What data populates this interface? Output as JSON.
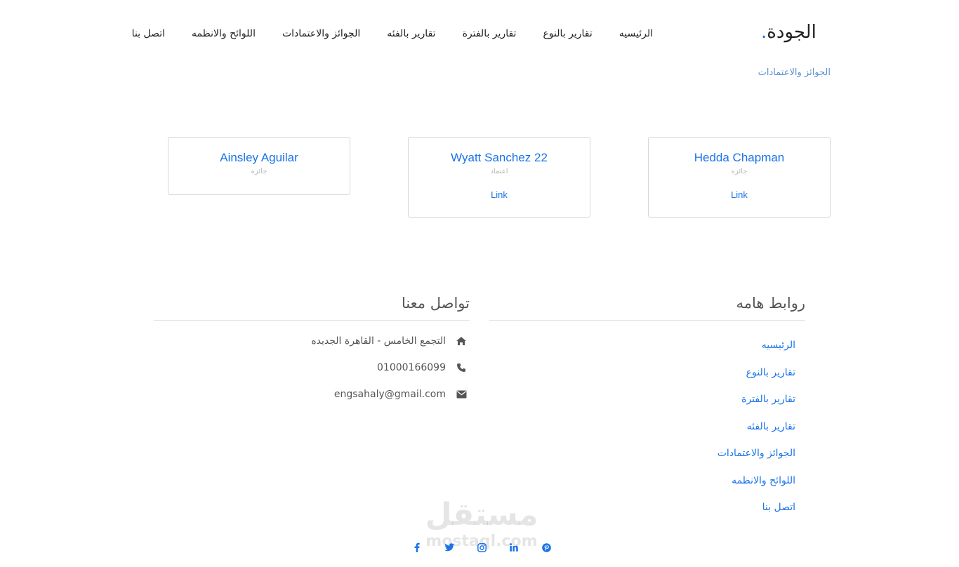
{
  "header": {
    "brand": "الجودة",
    "nav": [
      "الرئيسيه",
      "تقارير بالنوع",
      "تقارير بالفترة",
      "تقارير بالفئه",
      "الجوائز والاعتمادات",
      "اللوائح والانظمه",
      "اتصل بنا"
    ]
  },
  "breadcrumb": "الجوائز والاعتمادات",
  "cards": [
    {
      "name": "Hedda Chapman",
      "type": "جائزه",
      "link": "Link"
    },
    {
      "name": "Wyatt Sanchez 22",
      "type": "اعتماد",
      "link": "Link"
    },
    {
      "name": "Ainsley Aguilar",
      "type": "جائزه"
    }
  ],
  "footer": {
    "links_title": "روابط هامه",
    "links": [
      "الرئيسيه",
      "تقارير بالنوع",
      "تقارير بالفترة",
      "تقارير بالفئه",
      "الجوائز والاعتمادات",
      "اللوائح والانظمه",
      "اتصل بنا"
    ],
    "contact_title": "تواصل معنا",
    "address": "التجمع الخامس - القاهرة الجديده",
    "phone": "01000166099",
    "email": "engsahaly@gmail.com"
  },
  "social_icons": [
    "facebook-icon",
    "twitter-icon",
    "instagram-icon",
    "linkedin-icon",
    "pinterest-icon"
  ],
  "watermark": {
    "arabic": "مستقل",
    "latin": "mostaql.com"
  },
  "colors": {
    "accent": "#1a73e8",
    "text": "#222222",
    "muted": "#b5b5b5"
  }
}
